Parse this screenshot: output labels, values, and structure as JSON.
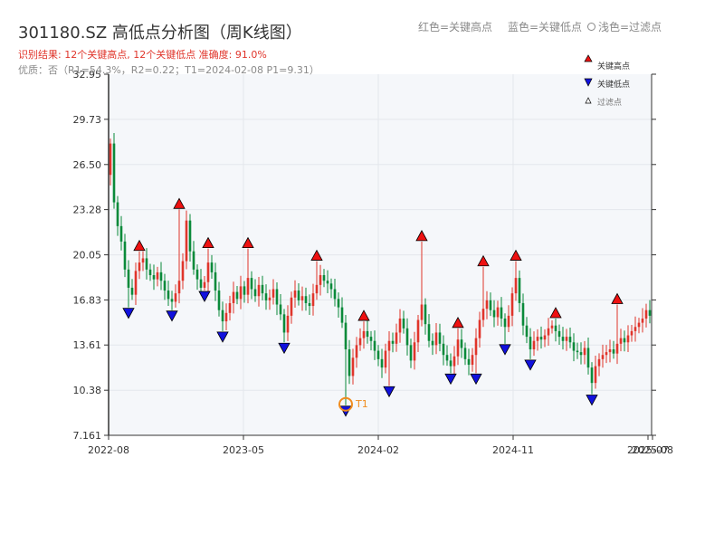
{
  "header": {
    "title": "301180.SZ 高低点分析图（周K线图）",
    "legend_red": "红色=关键高点",
    "legend_blue": "蓝色=关键低点",
    "legend_light": "浅色=过滤点",
    "result_line": "识别结果: 12个关键高点, 12个关键低点  准确度: 91.0%",
    "quality_line": "优质：否（R1=54.3%，R2=0.22；T1=2024-02-08 P1=9.31）"
  },
  "colors": {
    "up": "#e0352b",
    "down": "#0a8a3a",
    "high_marker": "#ee1111",
    "low_marker": "#1111dd",
    "t1": "#f08c1e",
    "plot_bg": "#f5f7fa",
    "grid": "#e4e7ec"
  },
  "chart_data": {
    "type": "candlestick",
    "yticks": [
      "7.161",
      "10.38",
      "13.61",
      "16.83",
      "20.05",
      "23.28",
      "26.50",
      "29.73",
      "32.95"
    ],
    "ylim": [
      7.161,
      32.95
    ],
    "xticks": [
      "2022-08",
      "2023-05",
      "2024-02",
      "2024-11",
      "2025-07",
      "2025-08"
    ],
    "legend": [
      "关键高点",
      "关键低点",
      "过滤点"
    ],
    "t1": {
      "label": "T1",
      "date": "2024-02-08",
      "price": 9.31
    },
    "key_highs": [
      {
        "week": 8,
        "price": 20.3
      },
      {
        "week": 19,
        "price": 23.3
      },
      {
        "week": 27,
        "price": 20.5
      },
      {
        "week": 38,
        "price": 20.5
      },
      {
        "week": 57,
        "price": 19.6
      },
      {
        "week": 70,
        "price": 15.3
      },
      {
        "week": 86,
        "price": 21.0
      },
      {
        "week": 96,
        "price": 14.8
      },
      {
        "week": 103,
        "price": 19.2
      },
      {
        "week": 112,
        "price": 19.6
      },
      {
        "week": 123,
        "price": 15.5
      },
      {
        "week": 140,
        "price": 16.5
      }
    ],
    "key_lows": [
      {
        "week": 5,
        "price": 16.3
      },
      {
        "week": 17,
        "price": 16.1
      },
      {
        "week": 26,
        "price": 17.5
      },
      {
        "week": 31,
        "price": 14.6
      },
      {
        "week": 48,
        "price": 13.8
      },
      {
        "week": 65,
        "price": 9.31
      },
      {
        "week": 77,
        "price": 10.7
      },
      {
        "week": 94,
        "price": 11.6
      },
      {
        "week": 101,
        "price": 11.6
      },
      {
        "week": 109,
        "price": 13.7
      },
      {
        "week": 116,
        "price": 12.6
      },
      {
        "week": 133,
        "price": 10.1
      }
    ],
    "closes": [
      28.0,
      23.8,
      22.1,
      21.0,
      19.0,
      17.7,
      17.2,
      18.9,
      19.5,
      19.8,
      19.0,
      18.6,
      18.3,
      18.8,
      18.2,
      17.5,
      16.9,
      16.7,
      17.3,
      18.2,
      19.6,
      22.5,
      20.3,
      19.0,
      18.3,
      17.7,
      18.1,
      19.5,
      18.8,
      17.5,
      16.1,
      15.3,
      15.9,
      16.6,
      17.4,
      16.9,
      17.8,
      17.2,
      18.4,
      17.6,
      17.1,
      17.9,
      17.3,
      16.8,
      17.0,
      17.6,
      16.5,
      15.8,
      14.5,
      15.7,
      17.0,
      17.5,
      16.8,
      17.1,
      16.6,
      16.4,
      17.3,
      17.9,
      18.6,
      18.2,
      18.0,
      17.6,
      16.9,
      16.3,
      15.2,
      13.3,
      11.4,
      12.7,
      13.6,
      14.1,
      14.6,
      14.2,
      13.9,
      13.2,
      12.6,
      12.0,
      13.2,
      13.9,
      13.7,
      14.5,
      15.5,
      14.8,
      13.6,
      12.5,
      13.8,
      15.4,
      16.5,
      15.1,
      13.9,
      13.6,
      14.5,
      13.7,
      12.9,
      12.5,
      12.1,
      12.8,
      14.0,
      13.4,
      12.6,
      12.2,
      12.9,
      14.1,
      15.4,
      16.2,
      16.8,
      16.1,
      15.6,
      16.3,
      15.5,
      14.9,
      15.7,
      17.3,
      18.4,
      16.6,
      15.0,
      14.2,
      13.3,
      13.9,
      14.2,
      14.0,
      14.3,
      14.8,
      15.0,
      14.6,
      14.2,
      13.9,
      14.2,
      13.8,
      13.2,
      13.1,
      12.9,
      13.4,
      12.0,
      10.9,
      12.1,
      12.6,
      12.9,
      13.1,
      13.3,
      13.0,
      13.7,
      14.1,
      13.8,
      14.3,
      14.6,
      14.9,
      15.2,
      15.5,
      16.1,
      15.7
    ]
  }
}
